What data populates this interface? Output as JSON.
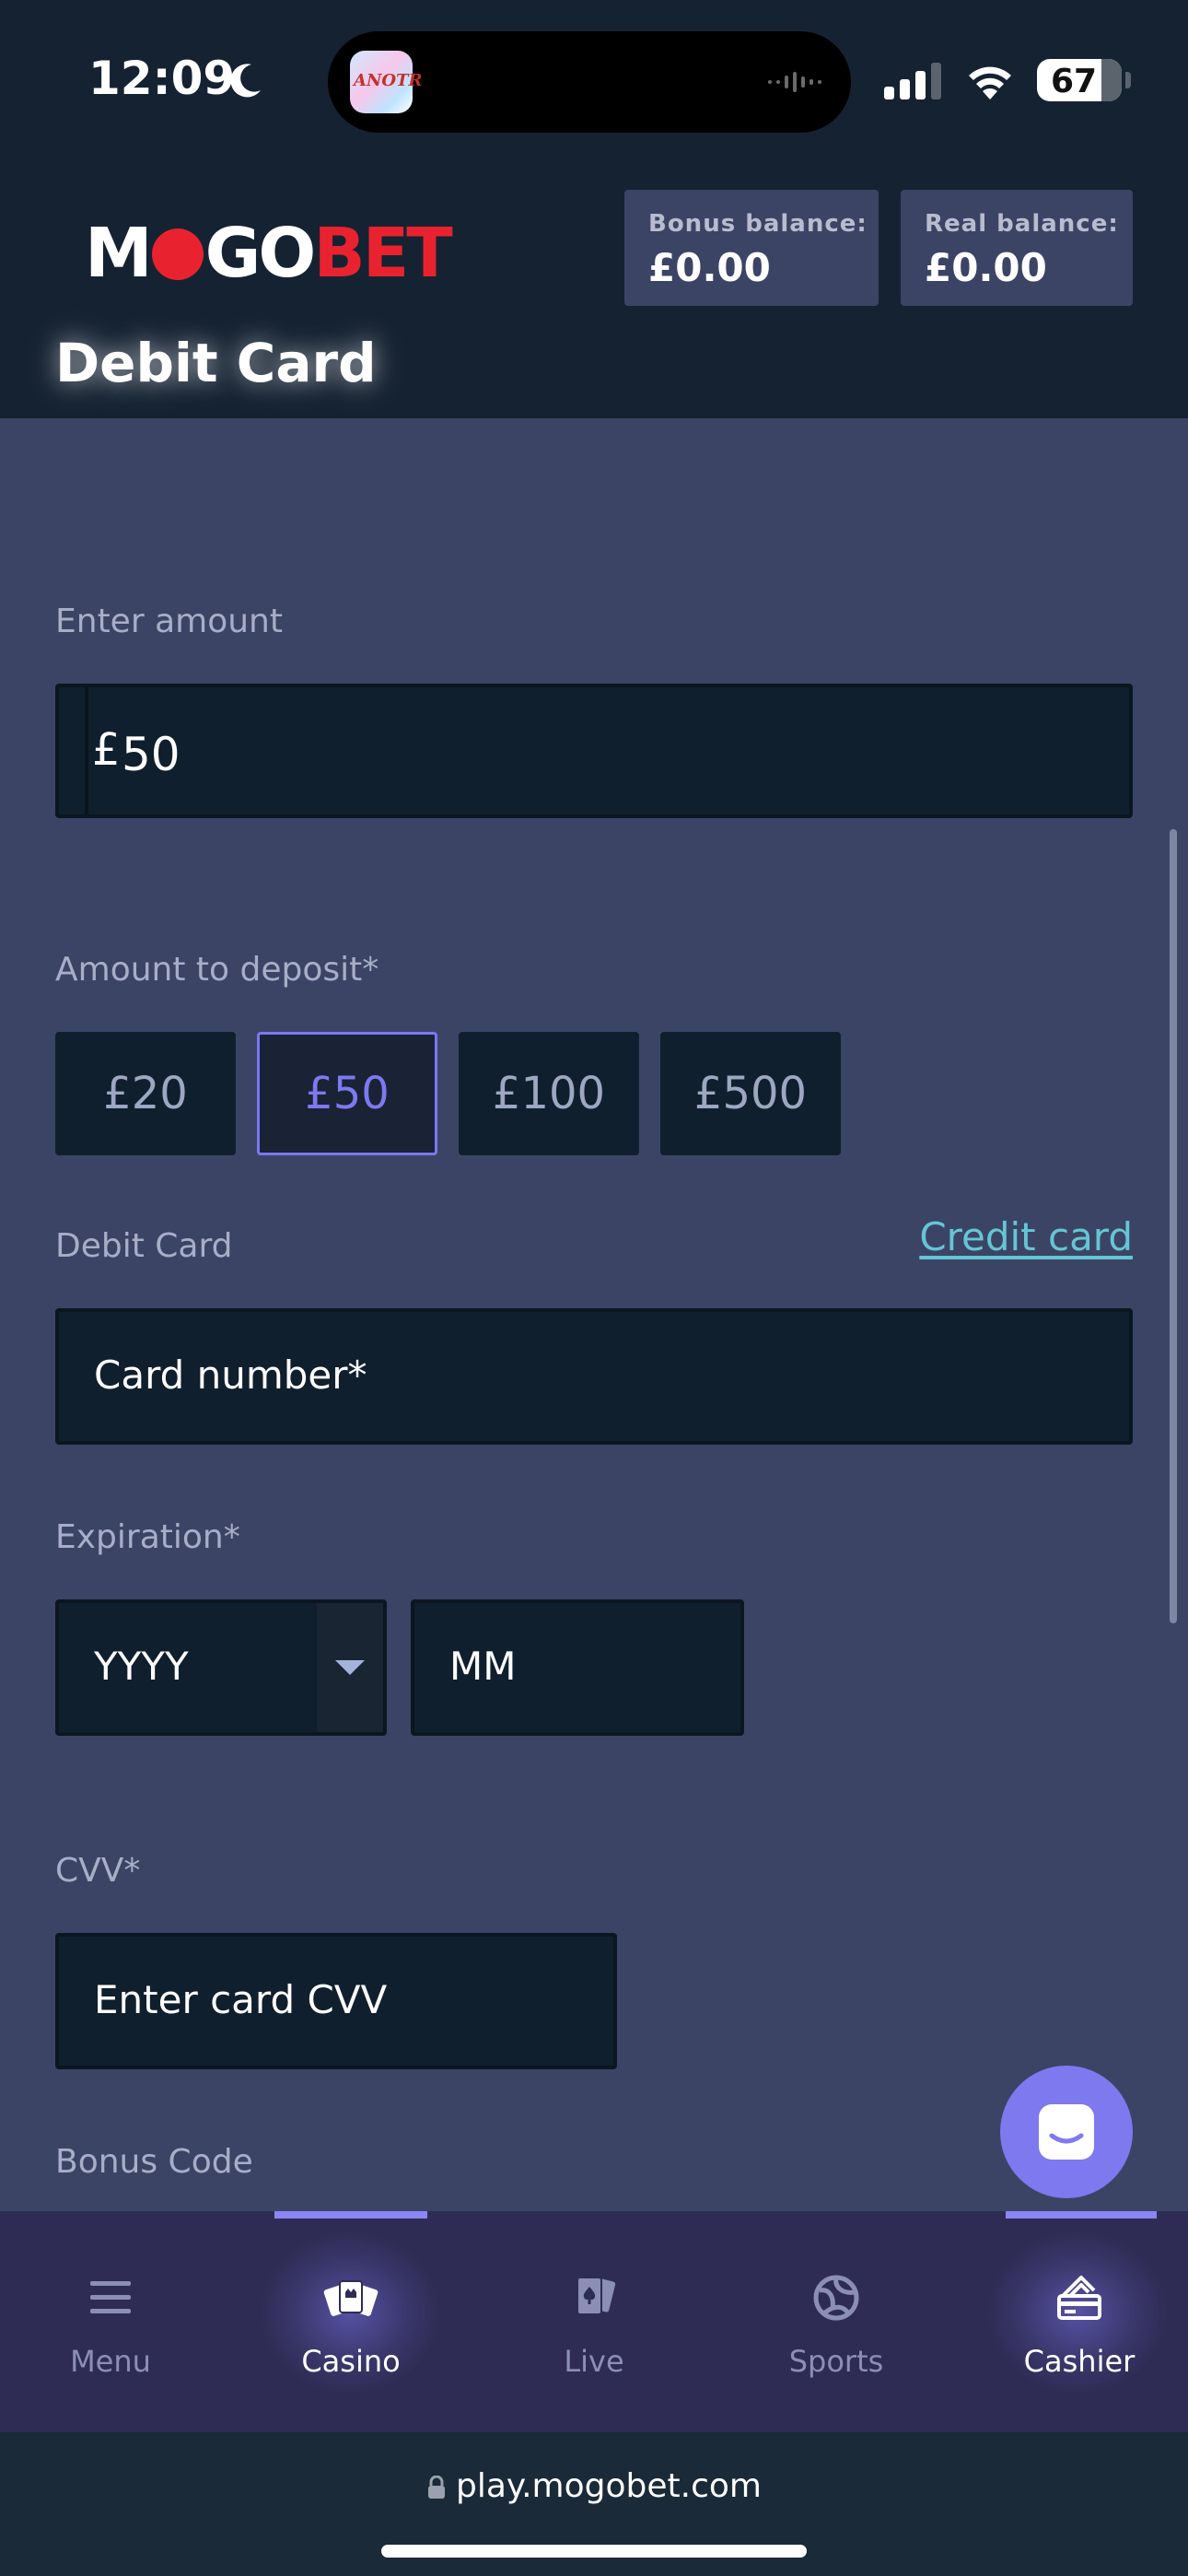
{
  "status_bar": {
    "time": "12:09",
    "battery": "67",
    "island_app_text": "ANOTR"
  },
  "header": {
    "logo_parts": [
      "M",
      "G",
      "O",
      "BET"
    ],
    "bonus_label": "Bonus balance:",
    "bonus_value": "£0.00",
    "real_label": "Real balance:",
    "real_value": "£0.00",
    "page_title": "Debit Card"
  },
  "form": {
    "amount_label": "Enter amount",
    "currency_symbol": "£",
    "amount_value": "50",
    "deposit_label": "Amount to deposit*",
    "chips": [
      "£20",
      "£50",
      "£100",
      "£500"
    ],
    "selected_chip": "£50",
    "card_section_label": "Debit Card",
    "credit_link": "Credit card",
    "card_number_placeholder": "Card number*",
    "expiration_label": "Expiration*",
    "year_placeholder": "YYYY",
    "month_placeholder": "MM",
    "cvv_label": "CVV*",
    "cvv_placeholder": "Enter card CVV",
    "bonus_code_label": "Bonus Code"
  },
  "bottom_nav": {
    "items": [
      {
        "label": "Menu",
        "icon": "menu-icon",
        "active": false
      },
      {
        "label": "Casino",
        "icon": "cards-icon",
        "active": true
      },
      {
        "label": "Live",
        "icon": "live-cards-icon",
        "active": false
      },
      {
        "label": "Sports",
        "icon": "football-icon",
        "active": false
      },
      {
        "label": "Cashier",
        "icon": "cashier-icon",
        "active": true
      }
    ]
  },
  "browser": {
    "url": "play.mogobet.com"
  },
  "colors": {
    "background": "#152232",
    "panel": "#3c4465",
    "accent": "#7f79f0",
    "link": "#64c6d4",
    "brand_red": "#e8232f"
  }
}
